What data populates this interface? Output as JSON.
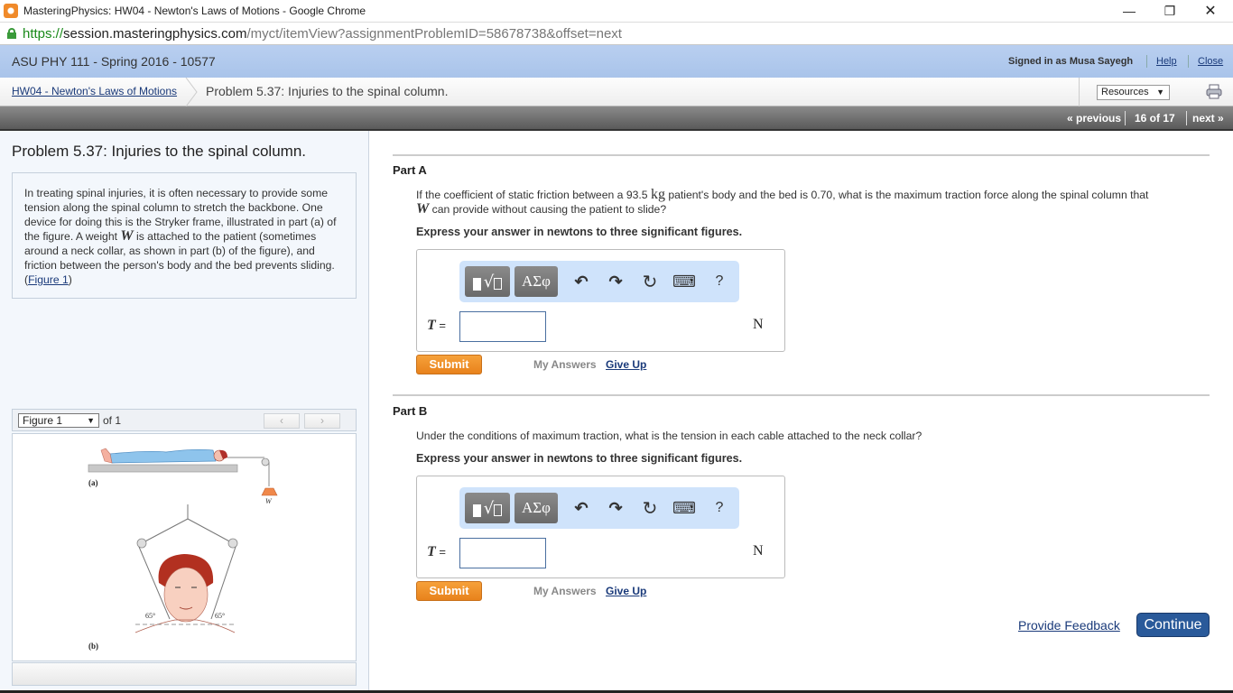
{
  "window": {
    "title": "MasteringPhysics: HW04 - Newton's Laws of Motions - Google Chrome",
    "controls": {
      "minimize": "—",
      "restore": "❐",
      "close": "✕"
    }
  },
  "address": {
    "scheme": "https://",
    "host": "session.masteringphysics.com",
    "path": "/myct/itemView?assignmentProblemID=58678738&offset=next"
  },
  "header": {
    "course": "ASU PHY 111 - Spring 2016 - 10577",
    "signed_in": "Signed in as Musa Sayegh",
    "help": "Help",
    "close": "Close"
  },
  "breadcrumb": {
    "assignment": "HW04 - Newton's Laws of Motions",
    "current": "Problem 5.37: Injuries to the spinal column.",
    "resources": "Resources",
    "resources_arrow": "▼"
  },
  "nav": {
    "previous": "« previous",
    "position": "16 of 17",
    "next": "next »"
  },
  "problem": {
    "title": "Problem 5.37: Injuries to the spinal column.",
    "intro_1": "In treating spinal injuries, it is often necessary to provide some tension along the spinal column to stretch the backbone. One device for doing this is the Stryker frame, illustrated in part (a) of the figure. A weight ",
    "intro_var": "W",
    "intro_2": " is attached to the patient (sometimes around a neck collar, as shown in part (b) of the figure), and friction between the person's body and the bed prevents sliding.(",
    "figure_link": "Figure 1",
    "intro_3": ")"
  },
  "figure": {
    "select": "Figure 1",
    "select_arrow": "▼",
    "of": "of 1",
    "prev": "‹",
    "next": "›",
    "label_a": "(a)",
    "label_b": "(b)",
    "weight_label": "W",
    "angle_left": "65°",
    "angle_right": "65°"
  },
  "parts": [
    {
      "title": "Part A",
      "q1": "If the coefficient of static friction between a 93.5 ",
      "unit_kg": "kg",
      "q2": " patient's body and the bed is 0.70, what is the maximum traction force along the spinal column that ",
      "var": "W",
      "q3": " can provide without causing the patient to slide?",
      "instruction": "Express your answer in newtons to three significant figures.",
      "answer_var": "T",
      "equals": " =",
      "answer_value": "",
      "unit": "N",
      "submit": "Submit",
      "my_answers": "My Answers",
      "give_up": "Give Up"
    },
    {
      "title": "Part B",
      "q1": "Under the conditions of maximum traction, what is the tension in each cable attached to the neck collar?",
      "instruction": "Express your answer in newtons to three significant figures.",
      "answer_var": "T",
      "equals": " =",
      "answer_value": "",
      "unit": "N",
      "submit": "Submit",
      "my_answers": "My Answers",
      "give_up": "Give Up"
    }
  ],
  "toolbar": {
    "templates": "√",
    "greek": "ΑΣφ",
    "undo": "↶",
    "redo": "↷",
    "reset": "↻",
    "keyboard": "⌨",
    "help": "?"
  },
  "footer": {
    "feedback": "Provide Feedback",
    "continue": "Continue"
  },
  "colors": {
    "header_blue": "#b9cff0",
    "submit_orange": "#f09a30",
    "continue_blue": "#2a5a9a",
    "toolbar_blue": "#cfe3fb",
    "link": "#1a3a7a"
  }
}
